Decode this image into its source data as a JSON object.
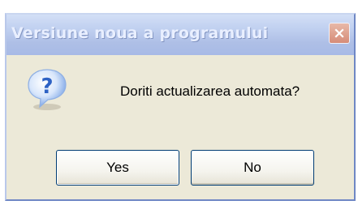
{
  "dialog": {
    "title": "Versiune noua a programului",
    "message": "Doriti actualizarea automata?",
    "icon": "question-icon",
    "buttons": {
      "yes_label": "Yes",
      "no_label": "No"
    },
    "close_icon": "close-icon"
  },
  "colors": {
    "titlebar": "#b7c7ea",
    "title_text": "#e9efff",
    "dialog_background": "#ece9d8",
    "close_button": "#d99a86",
    "button_border": "#003c74",
    "question_icon": "#3a6fd1"
  }
}
